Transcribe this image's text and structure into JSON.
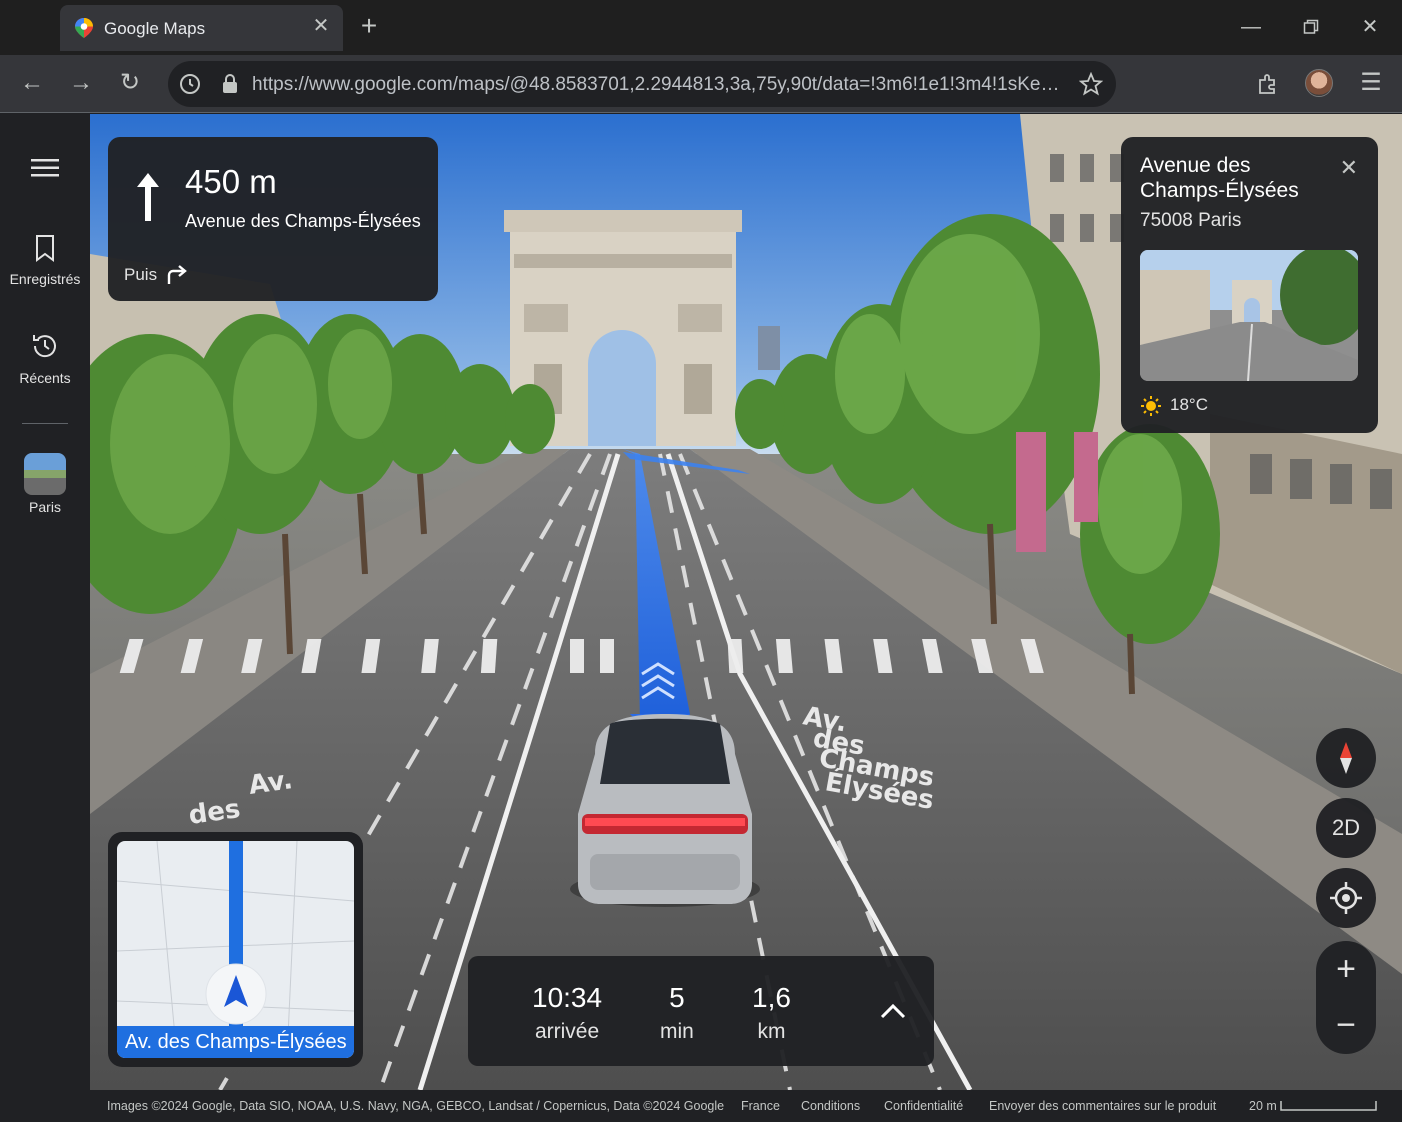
{
  "browser": {
    "tab_title": "Google Maps",
    "url": "https://www.google.com/maps/@48.8583701,2.2944813,3a,75y,90t/data=!3m6!1e1!3m4!1sKeX..",
    "icons": [
      "maps-pin-icon",
      "close-icon",
      "plus-icon",
      "minimize-icon",
      "restore-icon",
      "window-close-icon",
      "back-icon",
      "forward-icon",
      "reload-icon",
      "site-info-icon",
      "lock-icon",
      "bookmark-star-icon",
      "extensions-icon",
      "profile-avatar",
      "menu-icon"
    ]
  },
  "sidebar": {
    "items": [
      {
        "label": "Enregistrés",
        "icon": "bookmark-icon"
      },
      {
        "label": "Récents",
        "icon": "history-icon"
      },
      {
        "label": "Paris",
        "icon": "place-thumbnail"
      }
    ]
  },
  "direction": {
    "distance": "450 m",
    "street": "Avenue des Champs-Élysées",
    "then_label": "Puis"
  },
  "place": {
    "name": "Avenue des Champs-Élysées",
    "postal": "75008 Paris",
    "weather": "18°C"
  },
  "map_labels": {
    "road_marking_right": "Av. des Champs Élysées",
    "road_marking_left": "Av. des"
  },
  "controls": {
    "view_toggle": "2D"
  },
  "minimap": {
    "street": "Av. des Champs-Élysées"
  },
  "eta": {
    "arrival_time": "10:34",
    "arrival_label": "arrivée",
    "duration_value": "5",
    "duration_unit": "min",
    "distance_value": "1,6",
    "distance_unit": "km"
  },
  "footer": {
    "attribution": "Images ©2024 Google, Data SIO, NOAA, U.S. Navy, NGA, GEBCO, Landsat / Copernicus, Data ©2024 Google",
    "country": "France",
    "terms": "Conditions",
    "privacy": "Confidentialité",
    "feedback": "Envoyer des commentaires sur le produit",
    "scale": "20 m"
  },
  "colors": {
    "route_blue": "#1f6fe0",
    "panel_dark": "#202124"
  }
}
